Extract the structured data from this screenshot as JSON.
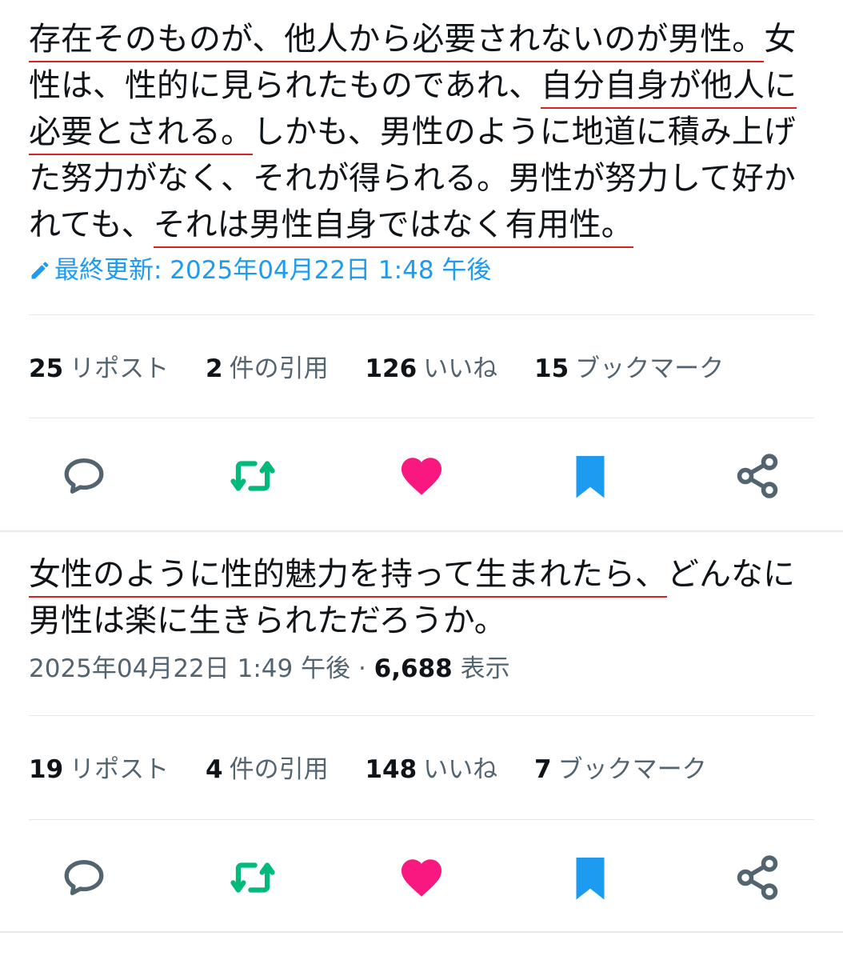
{
  "colors": {
    "text": "#0f1419",
    "secondary": "#536471",
    "link_blue": "#1d9bf0",
    "retweet_green": "#00ba7c",
    "like_pink": "#f91880",
    "underline_red": "#d52222"
  },
  "tweet1": {
    "lines": [
      {
        "a": "",
        "u": "存在そのものが、他人から必要されないのが男性。",
        "b": "女"
      },
      {
        "a": "性は、性的に見られたものであれ、",
        "u": "自分自身が他人に",
        "b": ""
      },
      {
        "a": "",
        "u": "必要とされる。",
        "b": "しかも、男性のように地道に積み上げ"
      },
      {
        "a": "た努力がなく、それが得られる。男性が努力して好か",
        "u": "",
        "b": ""
      },
      {
        "a": "れても、",
        "u": "それは男性自身ではなく有用性。",
        "b": ""
      }
    ],
    "edited_label": "最終更新: 2025年04月22日 1:48 午後",
    "stats": {
      "reposts": "25",
      "reposts_label": "リポスト",
      "quotes": "2",
      "quotes_label": "件の引用",
      "likes": "126",
      "likes_label": "いいね",
      "bookmarks": "15",
      "bookmarks_label": "ブックマーク"
    },
    "actions": [
      "reply-icon",
      "retweet-icon",
      "like-icon",
      "bookmark-icon",
      "share-icon"
    ]
  },
  "tweet2": {
    "lines": [
      {
        "a": "",
        "u": "女性のように性的魅力を持って生まれたら、",
        "b": "どんなに"
      },
      {
        "a": "男性は楽に生きられただろうか。",
        "u": "",
        "b": ""
      }
    ],
    "timestamp": "2025年04月22日 1:49 午後",
    "separator": " · ",
    "views": "6,688",
    "views_label": "表示",
    "stats": {
      "reposts": "19",
      "reposts_label": "リポスト",
      "quotes": "4",
      "quotes_label": "件の引用",
      "likes": "148",
      "likes_label": "いいね",
      "bookmarks": "7",
      "bookmarks_label": "ブックマーク"
    },
    "actions": [
      "reply-icon",
      "retweet-icon",
      "like-icon",
      "bookmark-icon",
      "share-icon"
    ]
  }
}
